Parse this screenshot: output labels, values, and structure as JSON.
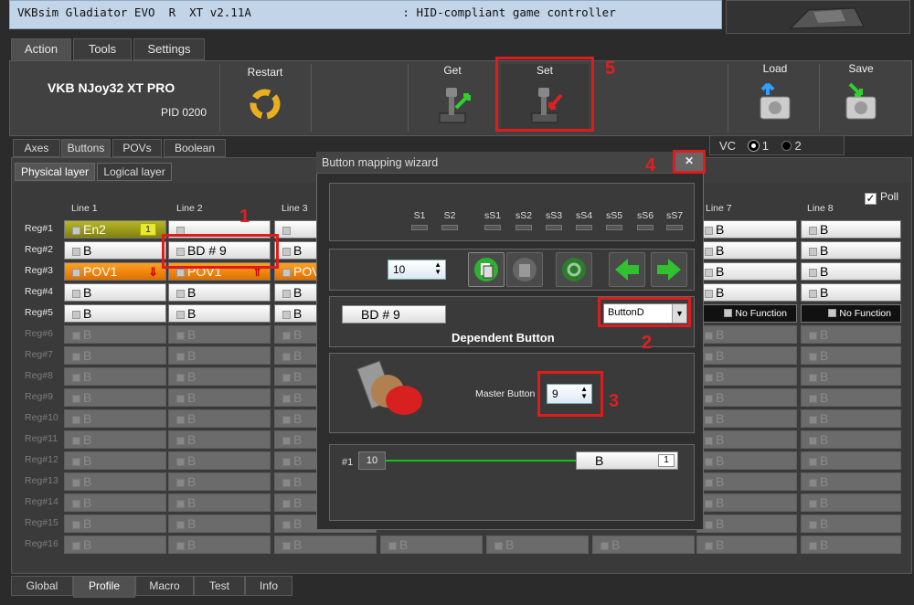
{
  "app_title": "VKBsim Gladiator EVO  R  XT v2.11A                      : HID-compliant game controller",
  "main_tabs": [
    "Action",
    "Tools",
    "Settings"
  ],
  "device": {
    "name": "VKB NJoy32 XT PRO",
    "pid": "PID 0200"
  },
  "toolbar": {
    "restart": "Restart",
    "get": "Get",
    "set": "Set",
    "load": "Load",
    "save": "Save"
  },
  "panel_tabs": [
    "Axes",
    "Buttons",
    "POVs",
    "Boolean"
  ],
  "sub_tabs": [
    "Physical layer",
    "Logical layer"
  ],
  "vc": {
    "label": "VC",
    "opt1": "1",
    "opt2": "2"
  },
  "poll": {
    "label": "Poll",
    "check": "✓"
  },
  "line_headers": [
    "Line 1",
    "Line 2",
    "Line 3",
    "Line 7",
    "Line 8"
  ],
  "regs": [
    "Reg#1",
    "Reg#2",
    "Reg#3",
    "Reg#4",
    "Reg#5",
    "Reg#6",
    "Reg#7",
    "Reg#8",
    "Reg#9",
    "Reg#10",
    "Reg#11",
    "Reg#12",
    "Reg#13",
    "Reg#14",
    "Reg#15",
    "Reg#16"
  ],
  "cells": {
    "en2": "En2",
    "en2_badge": "1",
    "b": "B",
    "bd9": "BD  # 9",
    "pov1": "POV1",
    "pov_partial": "POV",
    "nofunc": "No Function"
  },
  "wizard": {
    "title": "Button mapping wizard",
    "close": "✕",
    "s_labels": [
      "S1",
      "S2",
      "sS1",
      "sS2",
      "sS3",
      "sS4",
      "sS5",
      "sS6",
      "sS7"
    ],
    "spin_value": "10",
    "button_name": "BD  # 9",
    "type_select": "ButtonD",
    "type_desc": "Dependent Button",
    "master_label": "Master Button",
    "master_value": "9",
    "line_label": "#1",
    "line_value": "10",
    "line_target": "B",
    "line_target_badge": "1"
  },
  "annotations": [
    "1",
    "2",
    "3",
    "4",
    "5"
  ],
  "bottom_tabs": [
    "Global",
    "Profile",
    "Macro",
    "Test",
    "Info"
  ],
  "colors": {
    "annotation": "#e01b1b",
    "green_line": "#16c016",
    "olive": "#a0a020",
    "orange": "#f08a10"
  }
}
